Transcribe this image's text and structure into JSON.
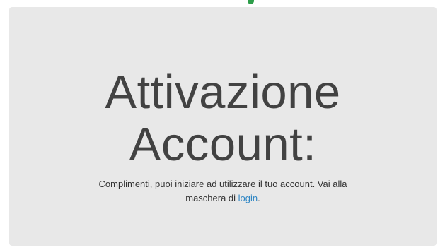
{
  "jumbotron": {
    "title_line1": "Attivazione",
    "title_line2": "Account:",
    "message_line1": "Complimenti, puoi iniziare ad utilizzare il tuo account. Vai alla",
    "message_line2_prefix": "maschera di ",
    "login_link": "login",
    "message_line2_suffix": "."
  },
  "colors": {
    "background": "#e8e8e8",
    "title": "#424242",
    "text": "#333333",
    "link": "#2f86c4",
    "indicator": "#2e9e4a"
  }
}
